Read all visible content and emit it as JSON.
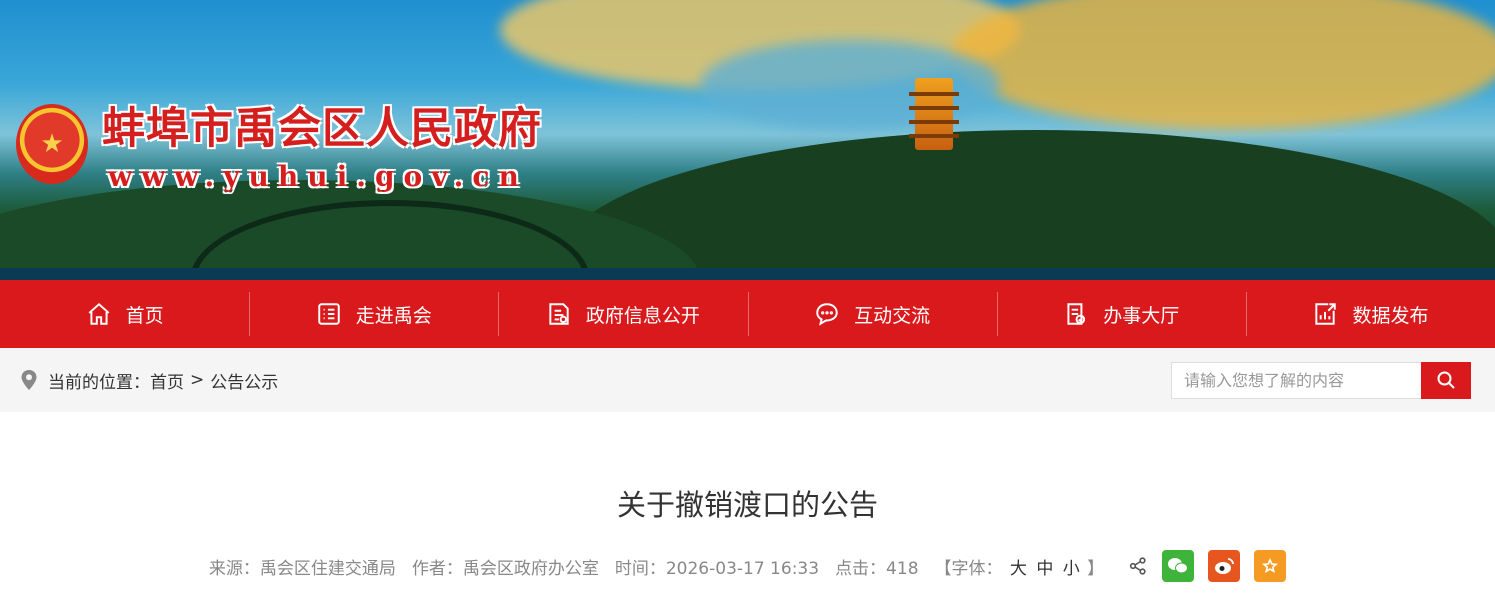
{
  "header": {
    "site_name": "蚌埠市禹会区人民政府",
    "site_url": "www.yuhui.gov.cn"
  },
  "nav": [
    {
      "label": "首页",
      "icon": "home-icon"
    },
    {
      "label": "走进禹会",
      "icon": "list-icon"
    },
    {
      "label": "政府信息公开",
      "icon": "document-icon"
    },
    {
      "label": "互动交流",
      "icon": "chat-icon"
    },
    {
      "label": "办事大厅",
      "icon": "checklist-icon"
    },
    {
      "label": "数据发布",
      "icon": "chart-icon"
    }
  ],
  "breadcrumb": {
    "prefix": "当前的位置：",
    "home": "首页",
    "separator": ">",
    "current": "公告公示"
  },
  "search": {
    "placeholder": "请输入您想了解的内容"
  },
  "article": {
    "title": "关于撤销渡口的公告",
    "source": "来源：禹会区住建交通局",
    "author": "作者：禹会区政府办公室",
    "time": "时间：2026-03-17 16:33",
    "clicks": "点击：418",
    "font_label_open": "【字体：",
    "font_large": "大",
    "font_medium": "中",
    "font_small": "小",
    "font_label_close": "】"
  },
  "colors": {
    "brand_red": "#d9191c",
    "wechat": "#3fb43a",
    "weibo": "#e8561f",
    "favorite": "#f59a23"
  }
}
